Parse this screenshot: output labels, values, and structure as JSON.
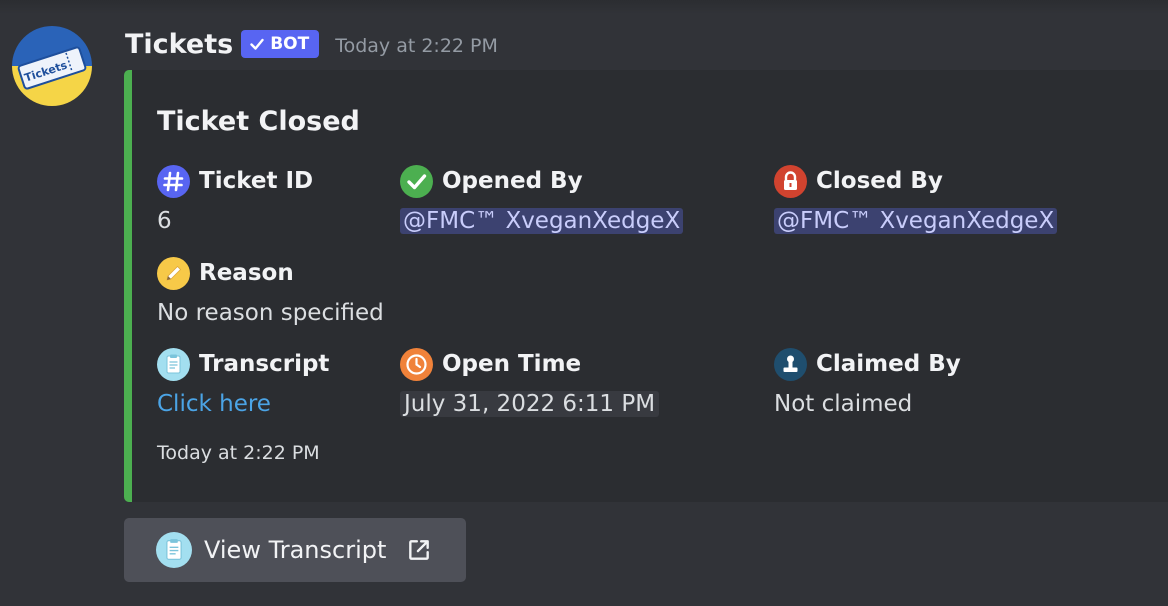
{
  "message": {
    "author": "Tickets",
    "bot_tag": "BOT",
    "timestamp": "Today at 2:22 PM",
    "avatar_text": "Tickets"
  },
  "embed": {
    "accent_color": "#4caf50",
    "title": "Ticket Closed",
    "fields": [
      {
        "name": "Ticket ID",
        "value": "6",
        "icon": "hash-icon"
      },
      {
        "name": "Opened By",
        "value": "@FMC™ XveganXedgeX",
        "icon": "check-icon"
      },
      {
        "name": "Closed By",
        "value": "@FMC™ XveganXedgeX",
        "icon": "lock-icon"
      },
      {
        "name": "Reason",
        "value": "No reason specified",
        "icon": "pencil-icon"
      },
      {
        "name": "Transcript",
        "value": "Click here",
        "icon": "clipboard-icon"
      },
      {
        "name": "Open Time",
        "value": "July 31, 2022 6:11 PM",
        "icon": "clock-icon"
      },
      {
        "name": "Claimed By",
        "value": "Not claimed",
        "icon": "stamp-icon"
      }
    ],
    "footer": "Today at 2:22 PM"
  },
  "button": {
    "label": "View Transcript",
    "icon": "clipboard-icon",
    "trailing_icon": "external-link-icon"
  },
  "colors": {
    "background": "#313338",
    "embed_background": "#2b2d31",
    "bot_tag": "#5865f2",
    "link": "#4ba4e6",
    "button": "#4e5058"
  }
}
